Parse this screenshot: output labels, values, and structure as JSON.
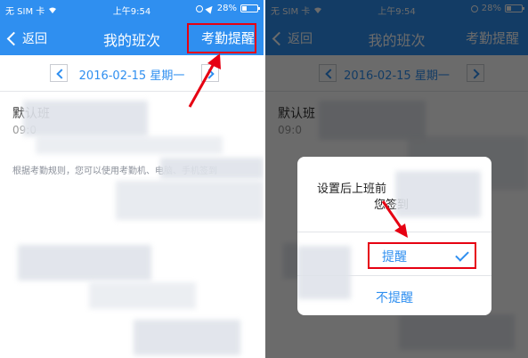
{
  "status_bar": {
    "carrier": "无 SIM 卡",
    "time": "上午9:54",
    "battery": "28%"
  },
  "nav": {
    "back_label": "返回",
    "title": "我的班次",
    "action_label": "考勤提醒"
  },
  "date_bar": {
    "date_text": "2016-02-15 星期一"
  },
  "shift": {
    "name": "默认班",
    "time": "09:0"
  },
  "hint_text": "根据考勤规则，您可以使用考勤机、电脑、手机签到",
  "dialog": {
    "message_line1": "设置后上班前",
    "message_line2": "您签到",
    "option_remind": "提醒",
    "option_no_remind": "不提醒"
  },
  "colors": {
    "brand_blue": "#2f8ff0",
    "annotation_red": "#e60012"
  }
}
